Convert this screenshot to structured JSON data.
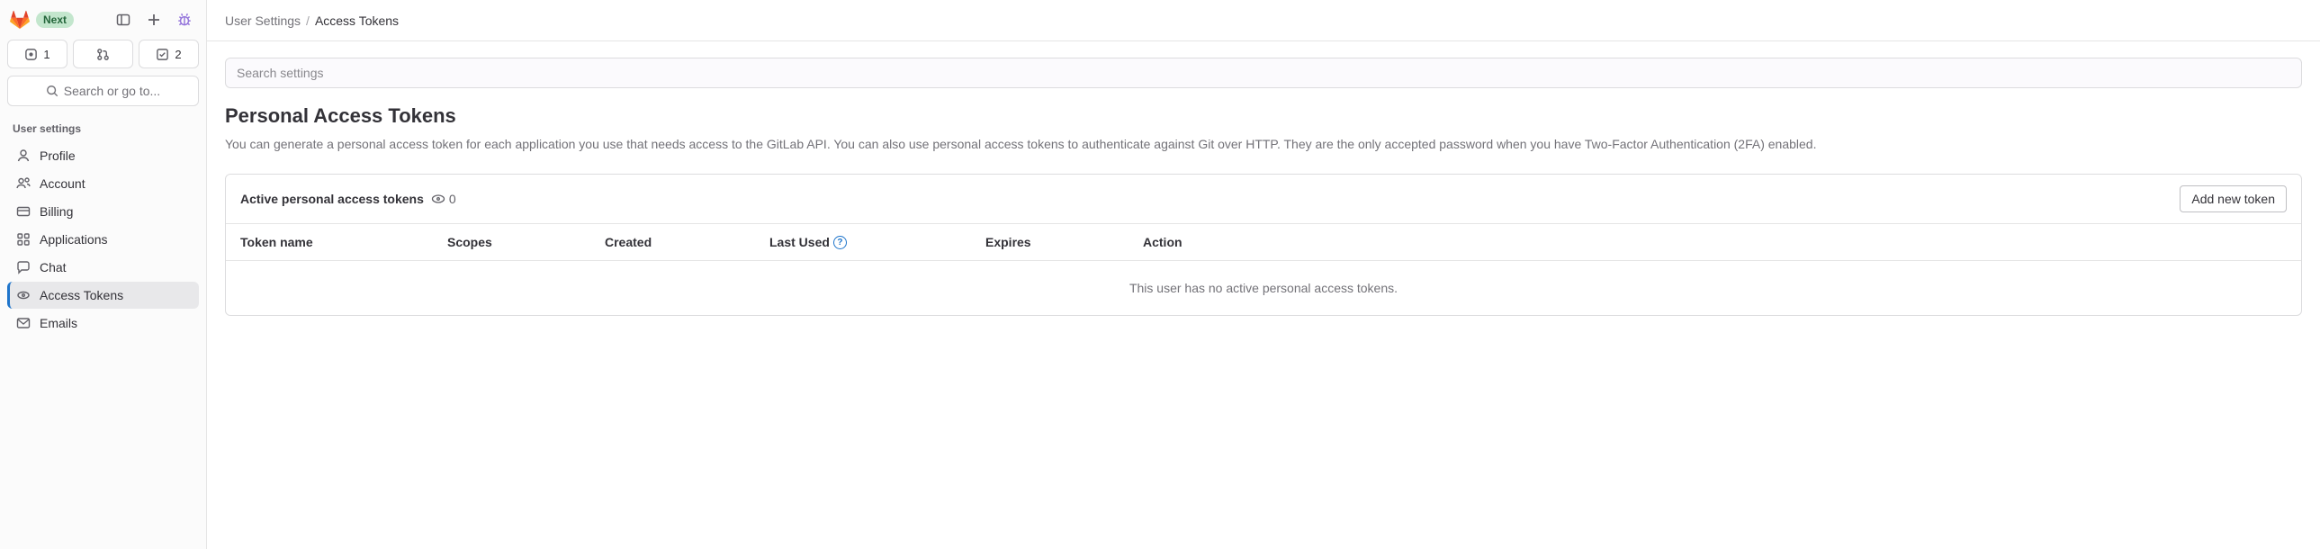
{
  "header": {
    "next_badge": "Next",
    "issues_count": "1",
    "todos_count": "2",
    "search_placeholder": "Search or go to..."
  },
  "sidebar": {
    "section_label": "User settings",
    "items": [
      {
        "label": "Profile"
      },
      {
        "label": "Account"
      },
      {
        "label": "Billing"
      },
      {
        "label": "Applications"
      },
      {
        "label": "Chat"
      },
      {
        "label": "Access Tokens"
      },
      {
        "label": "Emails"
      }
    ]
  },
  "breadcrumb": {
    "parent": "User Settings",
    "sep": "/",
    "current": "Access Tokens"
  },
  "page": {
    "search_placeholder": "Search settings",
    "title": "Personal Access Tokens",
    "description": "You can generate a personal access token for each application you use that needs access to the GitLab API. You can also use personal access tokens to authenticate against Git over HTTP. They are the only accepted password when you have Two-Factor Authentication (2FA) enabled."
  },
  "tokens": {
    "card_label": "Active personal access tokens",
    "count": "0",
    "add_button": "Add new token",
    "columns": {
      "name": "Token name",
      "scopes": "Scopes",
      "created": "Created",
      "last_used": "Last Used",
      "expires": "Expires",
      "action": "Action"
    },
    "empty_message": "This user has no active personal access tokens."
  }
}
